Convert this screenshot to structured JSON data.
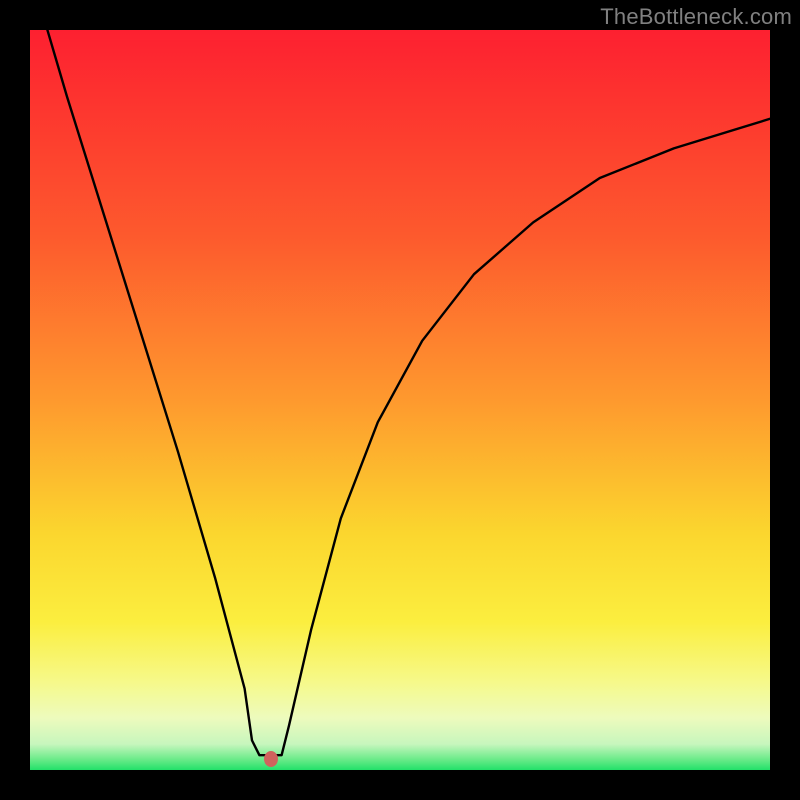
{
  "watermark": {
    "text": "TheBottleneck.com"
  },
  "colors": {
    "top": "#fd2030",
    "mid_upper": "#fe8c2e",
    "mid": "#fbe22f",
    "mid_lower": "#f6f989",
    "low": "#e9fcd2",
    "bottom": "#27e36b",
    "curve": "#000000",
    "marker": "#d0635d"
  },
  "marker": {
    "x_frac": 0.325,
    "y_frac": 0.985
  },
  "chart_data": {
    "type": "line",
    "title": "",
    "xlabel": "",
    "ylabel": "",
    "xlim": [
      0,
      1
    ],
    "ylim": [
      0,
      1
    ],
    "note": "Axis tick labels are not shown in the image; x and y are normalized fractions of the plot area (0 = left/bottom, 1 = right/top). Curve shows bottleneck/mismatch magnitude; minimum near x≈0.32 marks the balanced point.",
    "series": [
      {
        "name": "bottleneck-curve",
        "x": [
          0.0,
          0.05,
          0.1,
          0.15,
          0.2,
          0.25,
          0.29,
          0.3,
          0.31,
          0.34,
          0.35,
          0.38,
          0.42,
          0.47,
          0.53,
          0.6,
          0.68,
          0.77,
          0.87,
          1.0
        ],
        "y": [
          1.08,
          0.91,
          0.75,
          0.59,
          0.43,
          0.26,
          0.11,
          0.04,
          0.02,
          0.02,
          0.06,
          0.19,
          0.34,
          0.47,
          0.58,
          0.67,
          0.74,
          0.8,
          0.84,
          0.88
        ]
      }
    ],
    "annotations": [
      {
        "type": "point",
        "name": "optimal-marker",
        "x": 0.325,
        "y": 0.015
      }
    ]
  }
}
